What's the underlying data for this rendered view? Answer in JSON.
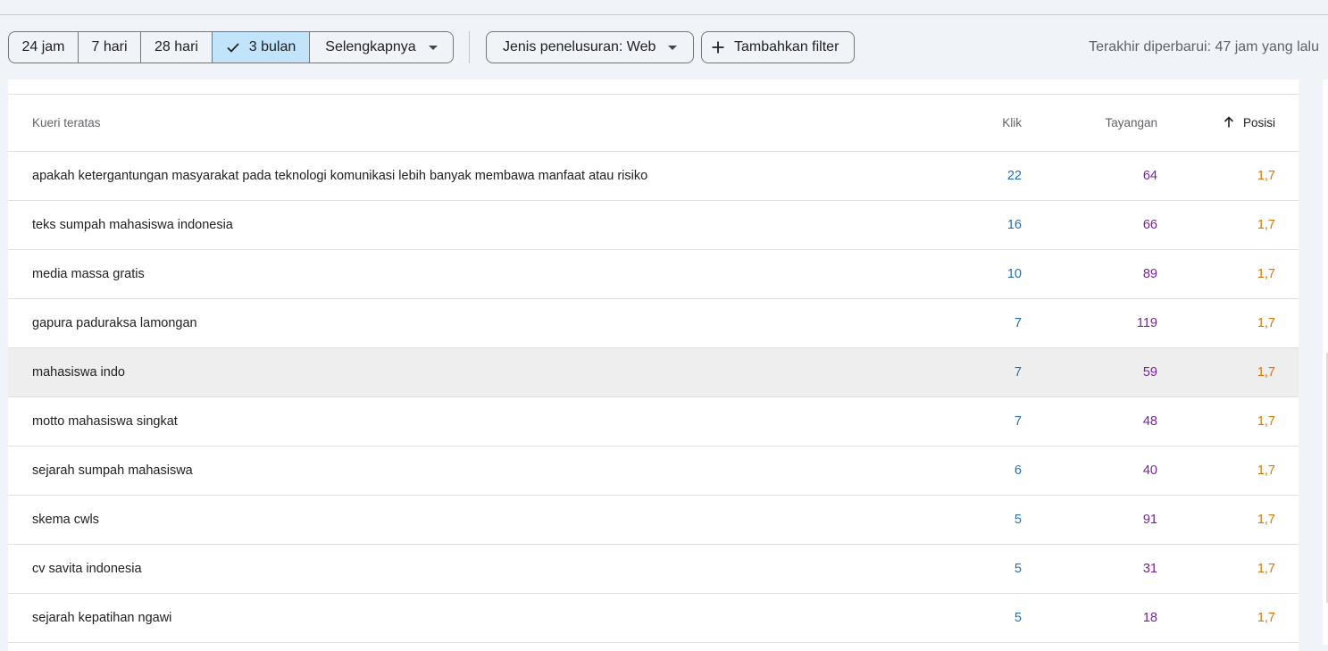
{
  "colors": {
    "click": "#1f6fb5",
    "impressions": "#7b1fa2",
    "position": "#d97706",
    "selected_chip": "#c2e4fb"
  },
  "date_range": {
    "options": [
      "24 jam",
      "7 hari",
      "28 hari",
      "3 bulan"
    ],
    "selected": "3 bulan",
    "more_label": "Selengkapnya"
  },
  "filters": {
    "search_type_label": "Jenis penelusuran: Web",
    "add_filter_label": "Tambahkan filter"
  },
  "last_updated": "Terakhir diperbarui: 47 jam yang lalu",
  "table": {
    "columns": {
      "query": "Kueri teratas",
      "clicks": "Klik",
      "impressions": "Tayangan",
      "position": "Posisi"
    },
    "sort": {
      "column": "position",
      "direction": "ascending"
    },
    "rows": [
      {
        "query": "apakah ketergantungan masyarakat pada teknologi komunikasi lebih banyak membawa manfaat atau risiko",
        "clicks": "22",
        "impressions": "64",
        "position": "1,7"
      },
      {
        "query": "teks sumpah mahasiswa indonesia",
        "clicks": "16",
        "impressions": "66",
        "position": "1,7"
      },
      {
        "query": "media massa gratis",
        "clicks": "10",
        "impressions": "89",
        "position": "1,7"
      },
      {
        "query": "gapura paduraksa lamongan",
        "clicks": "7",
        "impressions": "119",
        "position": "1,7"
      },
      {
        "query": "mahasiswa indo",
        "clicks": "7",
        "impressions": "59",
        "position": "1,7"
      },
      {
        "query": "motto mahasiswa singkat",
        "clicks": "7",
        "impressions": "48",
        "position": "1,7"
      },
      {
        "query": "sejarah sumpah mahasiswa",
        "clicks": "6",
        "impressions": "40",
        "position": "1,7"
      },
      {
        "query": "skema cwls",
        "clicks": "5",
        "impressions": "91",
        "position": "1,7"
      },
      {
        "query": "cv savita indonesia",
        "clicks": "5",
        "impressions": "31",
        "position": "1,7"
      },
      {
        "query": "sejarah kepatihan ngawi",
        "clicks": "5",
        "impressions": "18",
        "position": "1,7"
      }
    ]
  }
}
